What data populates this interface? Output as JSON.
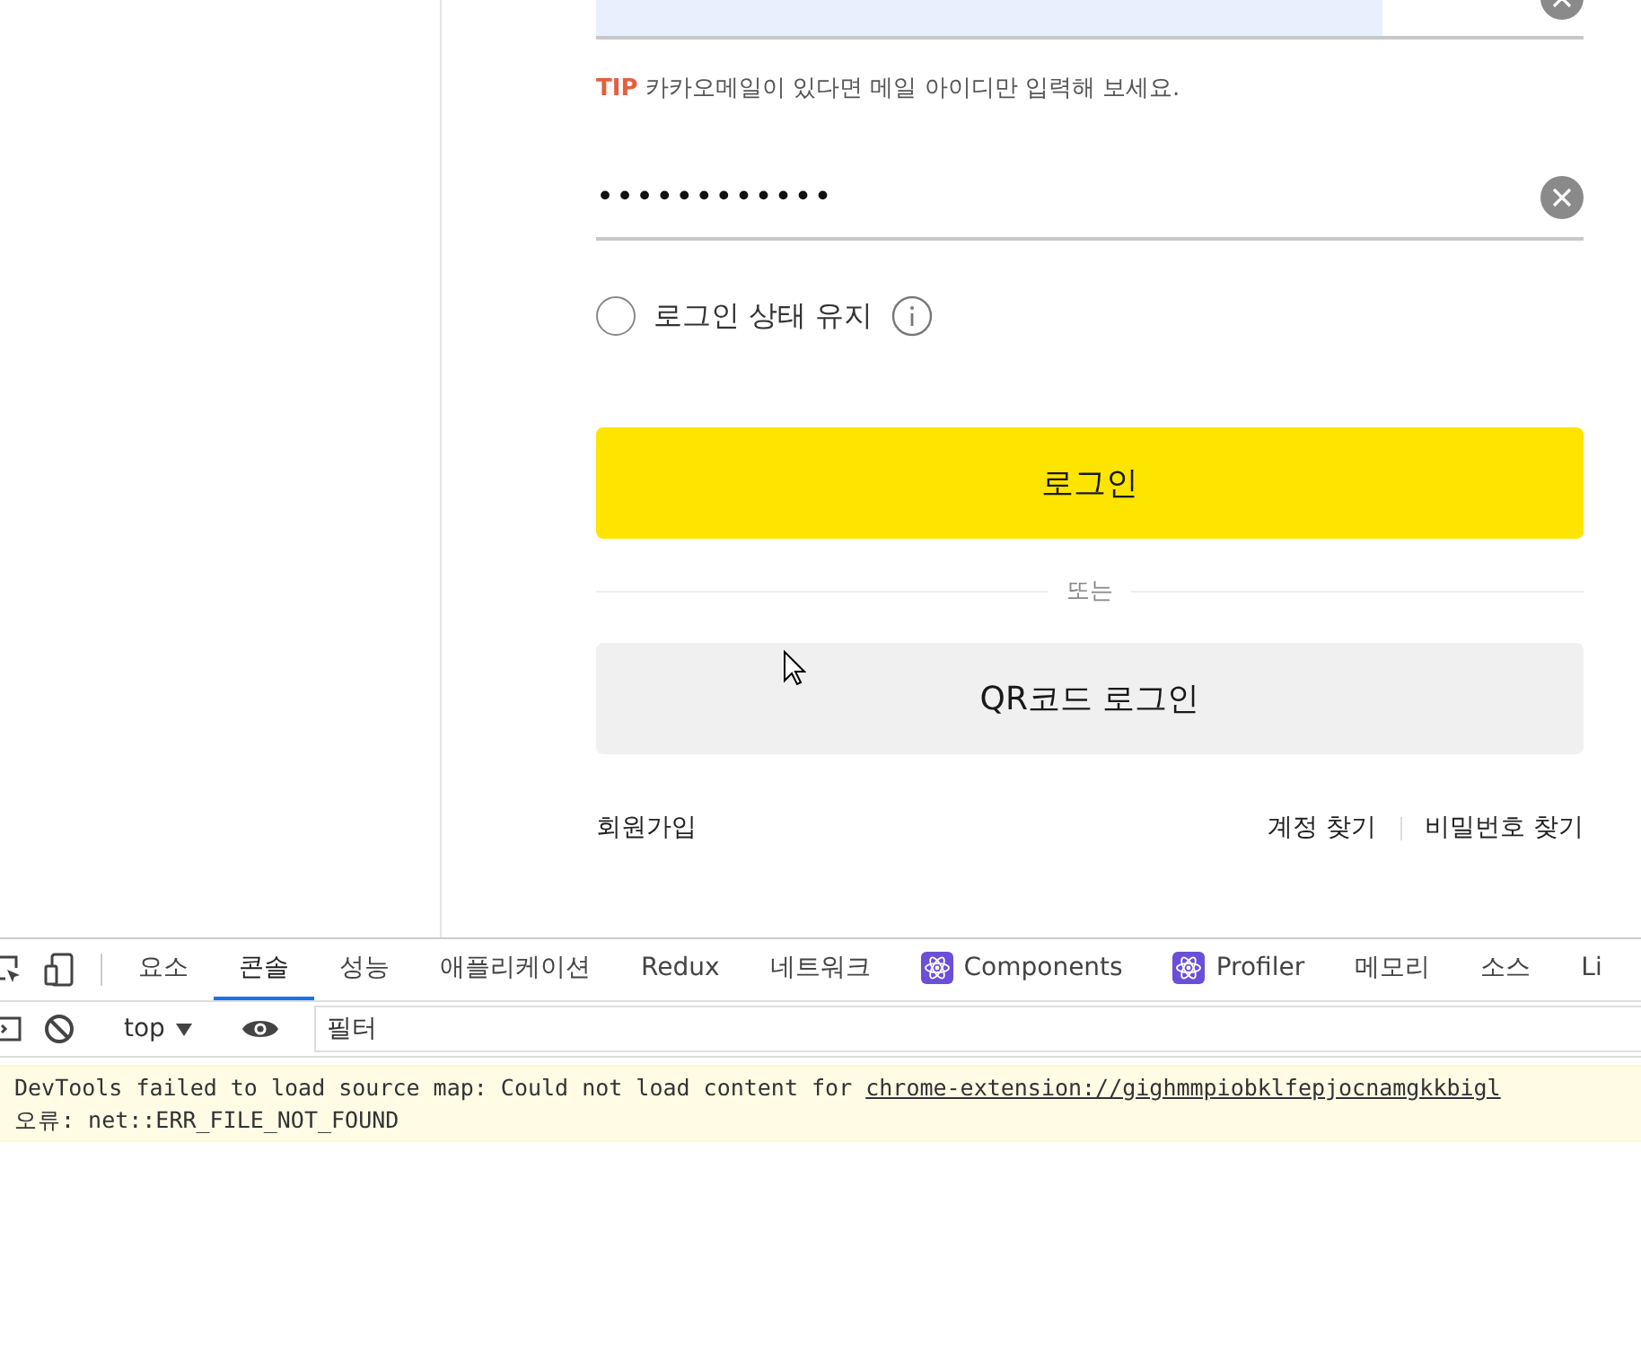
{
  "login": {
    "email_field": {
      "has_value": true
    },
    "tip": {
      "label": "TIP",
      "text": "카카오메일이 있다면 메일 아이디만 입력해 보세요."
    },
    "password_field": {
      "value": "••••••••••••"
    },
    "keep_login": {
      "label": "로그인 상태 유지",
      "checked": false
    },
    "login_button": "로그인",
    "divider_text": "또는",
    "qr_button": "QR코드 로그인",
    "links": {
      "signup": "회원가입",
      "find_account": "계정 찾기",
      "find_password": "비밀번호 찾기"
    }
  },
  "devtools": {
    "tabs": [
      {
        "label": "요소",
        "selected": false,
        "kind": "text"
      },
      {
        "label": "콘솔",
        "selected": true,
        "kind": "text"
      },
      {
        "label": "성능",
        "selected": false,
        "kind": "text"
      },
      {
        "label": "애플리케이션",
        "selected": false,
        "kind": "text"
      },
      {
        "label": "Redux",
        "selected": false,
        "kind": "text"
      },
      {
        "label": "네트워크",
        "selected": false,
        "kind": "text"
      },
      {
        "label": "Components",
        "selected": false,
        "kind": "react"
      },
      {
        "label": "Profiler",
        "selected": false,
        "kind": "react"
      },
      {
        "label": "메모리",
        "selected": false,
        "kind": "text"
      },
      {
        "label": "소스",
        "selected": false,
        "kind": "text"
      },
      {
        "label": "Li",
        "selected": false,
        "kind": "text"
      }
    ],
    "context": "top",
    "filter_placeholder": "필터",
    "messages": [
      {
        "text": "DevTools failed to load source map: Could not load content for ",
        "link": "chrome-extension://gighmmpiobklfepjocnamgkkbigl",
        "detail": "오류: net::ERR_FILE_NOT_FOUND"
      }
    ]
  }
}
